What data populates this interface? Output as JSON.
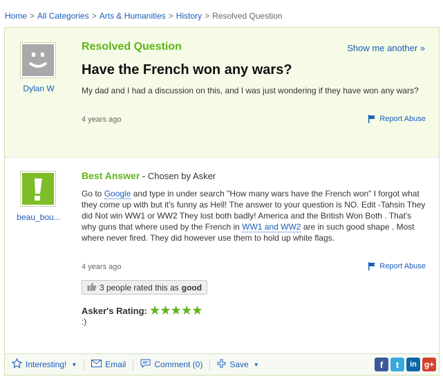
{
  "breadcrumb": {
    "items": [
      "Home",
      "All Categories",
      "Arts & Humanities",
      "History"
    ],
    "separator": ">",
    "current": "Resolved Question"
  },
  "question": {
    "status": "Resolved Question",
    "show_another": "Show me another »",
    "title": "Have the French won any wars?",
    "body": "My dad and I had a discussion on this, and I was just wondering if they have won any wars?",
    "time": "4 years ago",
    "report": "Report Abuse",
    "user": "Dylan W"
  },
  "answer": {
    "label": "Best Answer",
    "chosen_by": " - Chosen by Asker",
    "user": "beau_bou...",
    "body_1": "Go to ",
    "link_google": "Google",
    "body_2": " and type in under search \"How many wars have the French won\" I forgot what they come up with but it's funny as Hell! The answer to your question is NO. Edit -Tahsin They did Not win WW1 or WW2 They lost both badly! America and the British Won Both . That's why guns that where used by the French in ",
    "link_ww": "WW1 and WW2",
    "body_3": " are in such good shape . Most where never fired. They did however use them to hold up white flags.",
    "time": "4 years ago",
    "report": "Report Abuse",
    "rated_prefix": "3 people rated this as",
    "rated_value": "good",
    "askers_rating_label": "Asker's Rating:",
    "stars": "★★★★★",
    "rating_value": 5,
    "rating_comment": ":)"
  },
  "toolbar": {
    "interesting": "Interesting!",
    "email": "Email",
    "comment": "Comment (0)",
    "save": "Save"
  },
  "social": {
    "facebook": "f",
    "twitter": "t",
    "linkedin": "in",
    "googleplus": "g+"
  },
  "colors": {
    "accent_green": "#5fb41a",
    "link_blue": "#1a5cba",
    "question_bg": "#f5fbe6"
  }
}
